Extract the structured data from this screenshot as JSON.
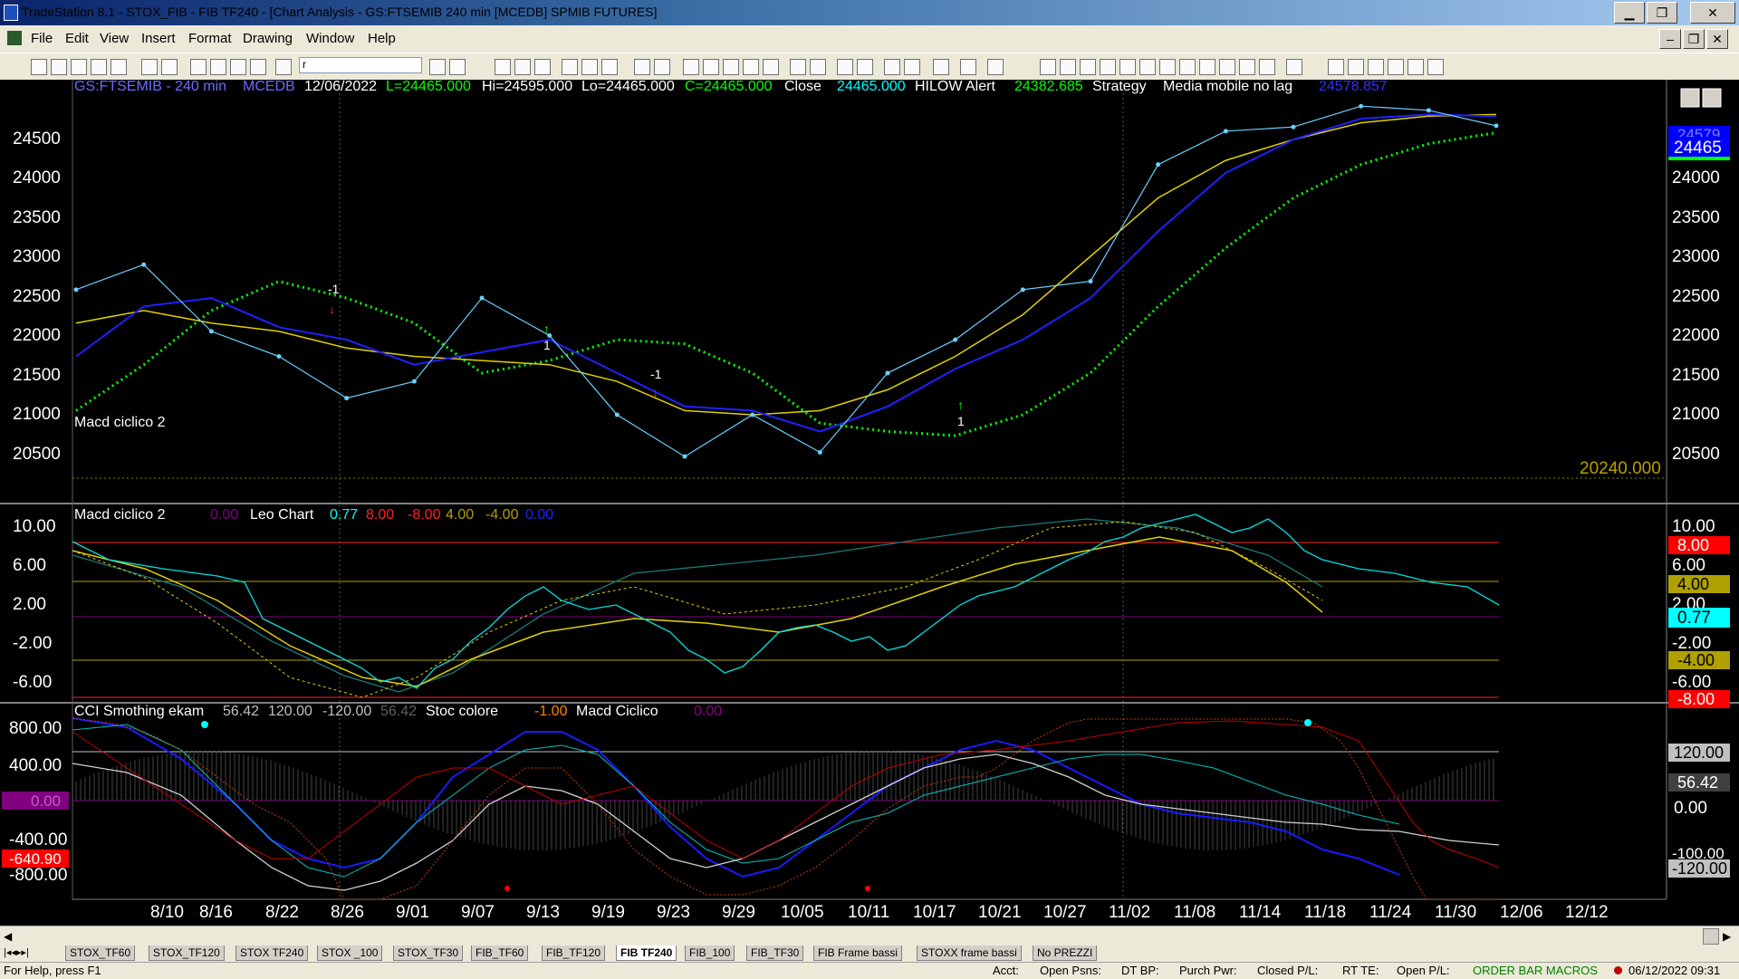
{
  "window": {
    "title": "TradeStation 8.1 - STOX_FIB - FIB TF240 - [Chart Analysis - GS:FTSEMIB  240 min  [MCEDB] SPMIB FUTURES]",
    "min": "▁",
    "max": "❐",
    "close": "✕",
    "child_min": "–",
    "child_restore": "❐",
    "child_close": "✕"
  },
  "menu": [
    "File",
    "Edit",
    "View",
    "Insert",
    "Format",
    "Drawing",
    "Window",
    "Help"
  ],
  "toolbar": {
    "symbol_value": "r"
  },
  "header": {
    "symbol": "GS:FTSEMIB - 240 min",
    "db": "MCEDB",
    "date": "12/06/2022",
    "last": "L=24465.000",
    "hi": "Hi=24595.000",
    "lo": "Lo=24465.000",
    "close_val": "C=24465.000",
    "close_label": "Close",
    "close_num": "24465.000",
    "alert": "HILOW Alert",
    "alert_num": "24382.685",
    "strategy": "Strategy",
    "media": "Media mobile no lag",
    "media_num": "24578.857"
  },
  "price_axis": [
    "24500",
    "24000",
    "23500",
    "23000",
    "22500",
    "22000",
    "21500",
    "21000",
    "20500"
  ],
  "price_tags": {
    "last": "24465",
    "ghost": "24579",
    "level": "20240.000"
  },
  "macd": {
    "title": "Macd ciclico 2",
    "v0": "0.00",
    "leo": "Leo Chart",
    "v1": "0.77",
    "v2": "8.00",
    "v3": "-8.00",
    "v4": "4.00",
    "v5": "-4.00",
    "v6": "0.00",
    "axis": [
      "10.00",
      "6.00",
      "2.00",
      "-2.00",
      "-6.00"
    ],
    "tags": [
      "10.00",
      "8.00",
      "6.00",
      "4.00",
      "2.00",
      "0.77",
      "-2.00",
      "-4.00",
      "-6.00",
      "-8.00"
    ]
  },
  "cci": {
    "title": "CCI Smothing ekam",
    "v1": "56.42",
    "v2": "120.00",
    "v3": "-120.00",
    "v4": "56.42",
    "stoc": "Stoc colore",
    "stoc_v": "-1.00",
    "macd": "Macd Ciclico",
    "macd_v": "0.00",
    "axis": [
      "800.00",
      "400.00",
      "0.00",
      "-400.00",
      "-640.90",
      "-800.00"
    ],
    "tags": [
      "120.00",
      "56.42",
      "0.00",
      "-100.00",
      "-120.00"
    ]
  },
  "signals": {
    "s1": "1",
    "s2": "1",
    "s3": "-1",
    "s4": "1",
    "s5": "-1"
  },
  "dates": [
    "8/10",
    "8/16",
    "8/22",
    "8/26",
    "9/01",
    "9/07",
    "9/13",
    "9/19",
    "9/23",
    "9/29",
    "10/05",
    "10/11",
    "10/17",
    "10/21",
    "10/27",
    "11/02",
    "11/08",
    "11/14",
    "11/18",
    "11/24",
    "11/30",
    "12/06",
    "12/12"
  ],
  "tabs": [
    "STOX_TF60",
    "STOX_TF120",
    "STOX TF240",
    "STOX _100",
    "STOX_TF30",
    "FIB_TF60",
    "FIB_TF120",
    "FIB TF240",
    "FIB_100",
    "FIB_TF30",
    "FIB Frame bassi",
    "STOXX frame bassi",
    "No PREZZI"
  ],
  "status": {
    "help": "For Help, press F1",
    "acct": "Acct:",
    "open_psns": "Open Psns:",
    "dt_bp": "DT BP:",
    "purch": "Purch Pwr:",
    "closed": "Closed P/L:",
    "rt": "RT TE:",
    "open_pl": "Open P/L:",
    "orderbar": "ORDER BAR  MACROS",
    "datetime": "06/12/2022 09:31"
  },
  "chart_data": {
    "type": "line",
    "title": "GS:FTSEMIB - 240 min",
    "x": [
      "8/10",
      "8/16",
      "8/22",
      "8/26",
      "9/01",
      "9/07",
      "9/13",
      "9/19",
      "9/23",
      "9/29",
      "10/05",
      "10/11",
      "10/17",
      "10/21",
      "10/27",
      "11/02",
      "11/08",
      "11/14",
      "11/18",
      "11/24",
      "11/30",
      "12/06"
    ],
    "ylim": [
      20240,
      24800
    ],
    "series": [
      {
        "values": [
          22500,
          22800,
          22000,
          21700,
          21200,
          21400,
          22400,
          21950,
          21000,
          20500,
          21000,
          20550,
          21500,
          21900,
          22500,
          22600,
          24000,
          24400,
          24450,
          24700,
          24650,
          24465
        ]
      },
      {
        "values": [
          21700,
          22300,
          22400,
          22050,
          21900,
          21600,
          21750,
          21900,
          21500,
          21100,
          21050,
          20800,
          21100,
          21550,
          21900,
          22400,
          23200,
          23900,
          24300,
          24550,
          24600,
          24578
        ]
      },
      {
        "values": [
          21050,
          21600,
          22250,
          22600,
          22400,
          22100,
          21500,
          21650,
          21900,
          21850,
          21500,
          20900,
          20800,
          20750,
          21000,
          21500,
          22300,
          23000,
          23600,
          24000,
          24250,
          24382
        ]
      },
      {
        "values": [
          22100,
          22250,
          22100,
          22000,
          21800,
          21700,
          21650,
          21600,
          21400,
          21050,
          21000,
          21050,
          21300,
          21700,
          22200,
          22900,
          23600,
          24050,
          24300,
          24500,
          24580,
          24600
        ]
      }
    ]
  }
}
